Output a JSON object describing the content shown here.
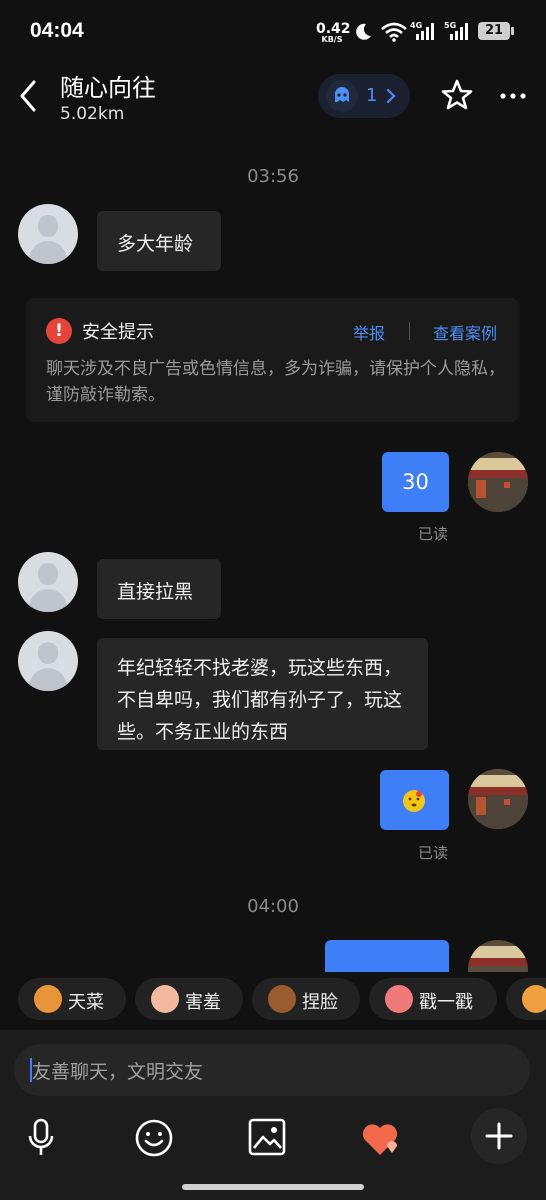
{
  "status_bar": {
    "time": "04:04",
    "net_speed_value": "0.42",
    "net_speed_unit": "KB/S",
    "net_4g": "4G",
    "net_5g": "5G",
    "battery": "21"
  },
  "header": {
    "title": "随心向往",
    "distance": "5.02km",
    "visitor_count": "1"
  },
  "messages": {
    "time1": "03:56",
    "in1": "多大年龄",
    "safety": {
      "title": "安全提示",
      "report": "举报",
      "view_cases": "查看案例",
      "body": "聊天涉及不良广告或色情信息，多为诈骗，请保护个人隐私，谨防敲诈勒索。"
    },
    "out1": "30",
    "read1": "已读",
    "in2": "直接拉黑",
    "in3": "年纪轻轻不找老婆，玩这些东西，不自卑吗，我们都有孙子了，玩这些。不务正业的东西",
    "read2": "已读",
    "time2": "04:00"
  },
  "quick_chips": [
    {
      "label": "天菜",
      "icon": "dog-emoji-icon"
    },
    {
      "label": "害羞",
      "icon": "shy-emoji-icon"
    },
    {
      "label": "捏脸",
      "icon": "bear-emoji-icon"
    },
    {
      "label": "戳一戳",
      "icon": "peach-emoji-icon"
    }
  ],
  "input": {
    "placeholder": "友善聊天，文明交友"
  },
  "colors": {
    "accent": "#3e7ef6",
    "warning": "#e5443b",
    "background": "#111111",
    "bubble_incoming": "#262626"
  }
}
